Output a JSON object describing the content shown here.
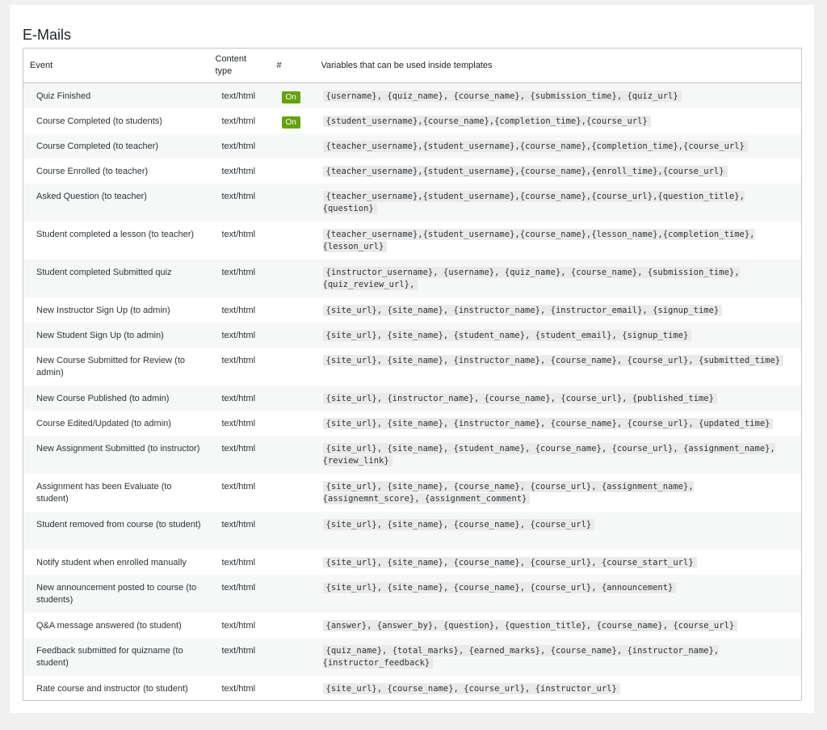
{
  "section_title": "E-Mails",
  "columns": {
    "event": "Event",
    "content_type": "Content type",
    "toggle": "#",
    "variables": "Variables that can be used inside templates"
  },
  "rows": [
    {
      "event": "Quiz Finished",
      "content_type": "text/html",
      "toggle": "On",
      "variables": "{username}, {quiz_name}, {course_name}, {submission_time}, {quiz_url}"
    },
    {
      "event": "Course Completed (to students)",
      "content_type": "text/html",
      "toggle": "On",
      "variables": "{student_username},{course_name},{completion_time},{course_url}"
    },
    {
      "event": "Course Completed (to teacher)",
      "content_type": "text/html",
      "toggle": "",
      "variables": "{teacher_username},{student_username},{course_name},{completion_time},{course_url}"
    },
    {
      "event": "Course Enrolled (to teacher)",
      "content_type": "text/html",
      "toggle": "",
      "variables": "{teacher_username},{student_username},{course_name},{enroll_time},{course_url}"
    },
    {
      "event": "Asked Question (to teacher)",
      "content_type": "text/html",
      "toggle": "",
      "variables": "{teacher_username},{student_username},{course_name},{course_url},{question_title},{question}"
    },
    {
      "event": "Student completed a lesson (to teacher)",
      "content_type": "text/html",
      "toggle": "",
      "variables": "{teacher_username},{student_username},{course_name},{lesson_name},{completion_time},{lesson_url}"
    },
    {
      "event": "Student completed Submitted quiz",
      "content_type": "text/html",
      "toggle": "",
      "variables": "{instructor_username}, {username}, {quiz_name}, {course_name}, {submission_time}, {quiz_review_url},"
    },
    {
      "event": "New Instructor Sign Up (to admin)",
      "content_type": "text/html",
      "toggle": "",
      "variables": "{site_url}, {site_name}, {instructor_name}, {instructor_email}, {signup_time}"
    },
    {
      "event": "New Student Sign Up (to admin)",
      "content_type": "text/html",
      "toggle": "",
      "variables": "{site_url}, {site_name}, {student_name}, {student_email}, {signup_time}"
    },
    {
      "event": "New Course Submitted for Review (to admin)",
      "content_type": "text/html",
      "toggle": "",
      "variables": "{site_url}, {site_name}, {instructor_name}, {course_name}, {course_url}, {submitted_time}"
    },
    {
      "event": "New Course Published (to admin)",
      "content_type": "text/html",
      "toggle": "",
      "variables": "{site_url}, {instructor_name}, {course_name}, {course_url}, {published_time}"
    },
    {
      "event": "Course Edited/Updated (to admin)",
      "content_type": "text/html",
      "toggle": "",
      "variables": "{site_url}, {site_name}, {instructor_name}, {course_name}, {course_url}, {updated_time}"
    },
    {
      "event": "New Assignment Submitted (to instructor)",
      "content_type": "text/html",
      "toggle": "",
      "variables": "{site_url}, {site_name}, {student_name}, {course_name}, {course_url}, {assignment_name}, {review_link}"
    },
    {
      "event": "Assignment has been Evaluate (to student)",
      "content_type": "text/html",
      "toggle": "",
      "variables": "{site_url}, {site_name}, {course_name}, {course_url}, {assignment_name}, {assignemnt_score}, {assignment_comment}"
    },
    {
      "event": "Student removed from course (to student)",
      "content_type": "text/html",
      "toggle": "",
      "variables": "{site_url}, {site_name}, {course_name}, {course_url}"
    },
    {
      "event": "Notify student when enrolled manually",
      "content_type": "text/html",
      "toggle": "",
      "variables": "{site_url}, {site_name}, {course_name}, {course_url}, {course_start_url}"
    },
    {
      "event": "New announcement posted to course (to students)",
      "content_type": "text/html",
      "toggle": "",
      "variables": "{site_url}, {site_name}, {course_name}, {course_url}, {announcement}"
    },
    {
      "event": "Q&A message answered (to student)",
      "content_type": "text/html",
      "toggle": "",
      "variables": "{answer}, {answer_by}, {question}, {question_title}, {course_name}, {course_url}"
    },
    {
      "event": "Feedback submitted for quizname (to student)",
      "content_type": "text/html",
      "toggle": "",
      "variables": "{quiz_name}, {total_marks}, {earned_marks}, {course_name}, {instructor_name}, {instructor_feedback}"
    },
    {
      "event": "Rate course and instructor (to student)",
      "content_type": "text/html",
      "toggle": "",
      "variables": "{site_url}, {course_name}, {course_url}, {instructor_url}"
    }
  ],
  "colors": {
    "on_badge": "#65a30d",
    "row_alt": "#f6f7f7",
    "border": "#c3c4c7",
    "page_bg": "#f0f0f1"
  }
}
